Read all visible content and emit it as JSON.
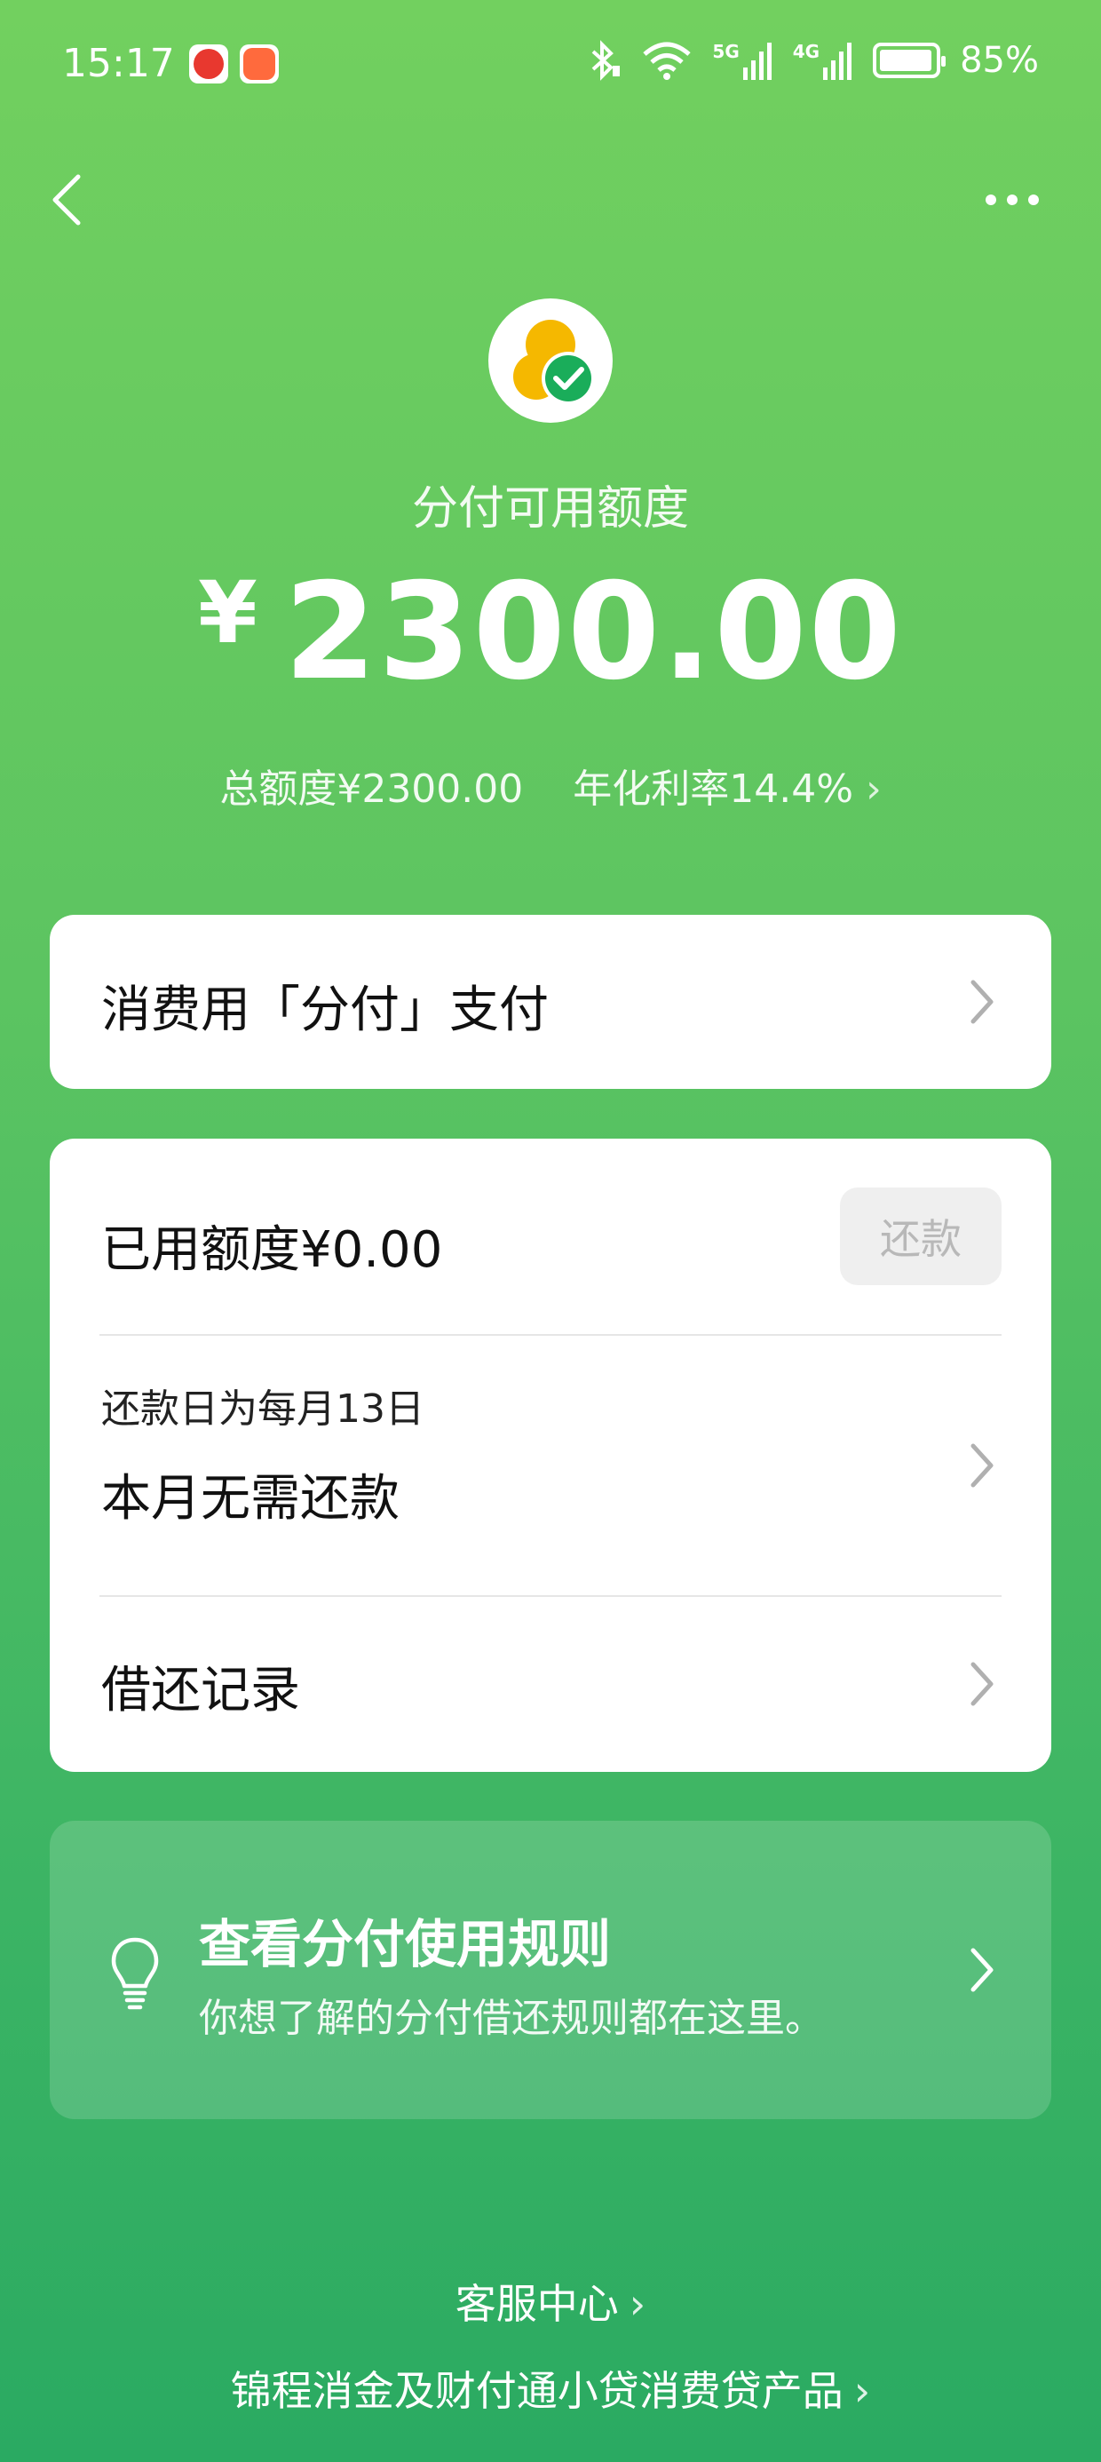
{
  "status_bar": {
    "time": "15:17",
    "network_5g": "5G",
    "network_4g": "4G",
    "battery": "85%"
  },
  "header": {
    "credit_label": "分付可用额度",
    "currency_symbol": "¥",
    "available_amount": "2300.00",
    "total_limit": "总额度¥2300.00",
    "annual_rate": "年化利率14.4%"
  },
  "pay_card": {
    "title": "消费用「分付」支付"
  },
  "bill_card": {
    "used_limit": "已用额度¥0.00",
    "repay_button": "还款",
    "repay_day": "还款日为每月13日",
    "repay_status": "本月无需还款",
    "records": "借还记录"
  },
  "rules_card": {
    "title": "查看分付使用规则",
    "description": "你想了解的分付借还规则都在这里。"
  },
  "footer": {
    "service_center": "客服中心",
    "loan_products": "锦程消金及财付通小贷消费贷产品"
  },
  "icons": {
    "back": "back-arrow-icon",
    "more": "more-dots-icon",
    "chevron": "chevron-right-icon",
    "bulb": "lightbulb-icon",
    "logo": "fenfu-logo-icon"
  },
  "colors": {
    "bg_top": "#72d05f",
    "bg_bottom": "#2aaa62",
    "logo_yellow": "#f5b800",
    "logo_green": "#1aad5a"
  }
}
